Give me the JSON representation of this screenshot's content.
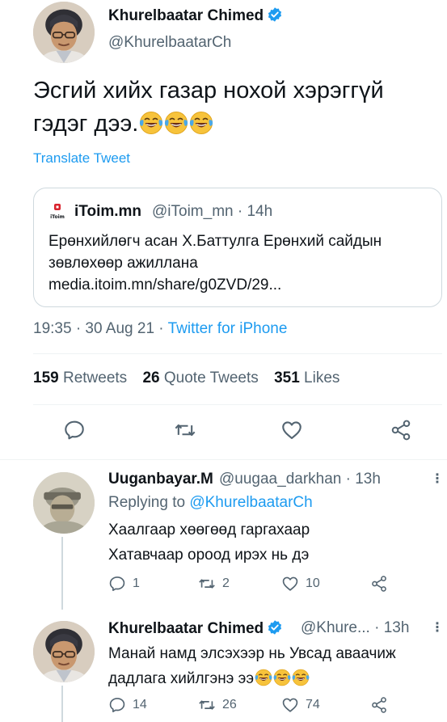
{
  "main_tweet": {
    "author_name": "Khurelbaatar Chimed",
    "author_handle": "@KhurelbaatarCh",
    "text": "Эсгий хийх газар нохой хэрэггүй гэдэг дээ.",
    "emojis": [
      "joy",
      "joy",
      "joy"
    ],
    "translate_label": "Translate Tweet",
    "quote": {
      "name": "iToim.mn",
      "meta": "@iToim_mn · 14h",
      "text": "Ерөнхийлөгч асан Х.Баттулга Ерөнхий сайдын зөвлөхөөр ажиллана media.itoim.mn/share/g0ZVD/29..."
    },
    "timestamp": "19:35 · 30 Aug 21 · ",
    "source": "Twitter for iPhone",
    "stats": {
      "retweets_count": "159",
      "retweets_label": "Retweets",
      "quotes_count": "26",
      "quotes_label": "Quote Tweets",
      "likes_count": "351",
      "likes_label": "Likes"
    },
    "actions": [
      "reply-icon",
      "retweet-icon",
      "like-icon",
      "share-icon"
    ]
  },
  "replies": [
    {
      "name": "Uuganbayar.M",
      "meta": "@uugaa_darkhan · 13h",
      "replying_prefix": "Replying to ",
      "replying_to": "@KhurelbaatarCh",
      "text_line1": "Хаалгаар хөөгөөд гаргахаар",
      "text_line2": "Хатавчаар ороод ирэх нь дэ",
      "reply_count": "1",
      "retweet_count": "2",
      "like_count": "10"
    },
    {
      "name": "Khurelbaatar Chimed",
      "meta": "@Khure... · 13h",
      "text_line1": "Манай намд элсэхээр нь Увсад аваачиж",
      "text_line2": "дадлага хийлгэнэ ээ",
      "emojis": [
        "joy",
        "joy",
        "joy"
      ],
      "reply_count": "14",
      "retweet_count": "26",
      "like_count": "74"
    }
  ],
  "colors": {
    "accent": "#1d9bf0",
    "secondary_text": "#536471",
    "primary_text": "#0f1419",
    "border": "#cfd9de",
    "itoim_brand": "#d9232d"
  }
}
